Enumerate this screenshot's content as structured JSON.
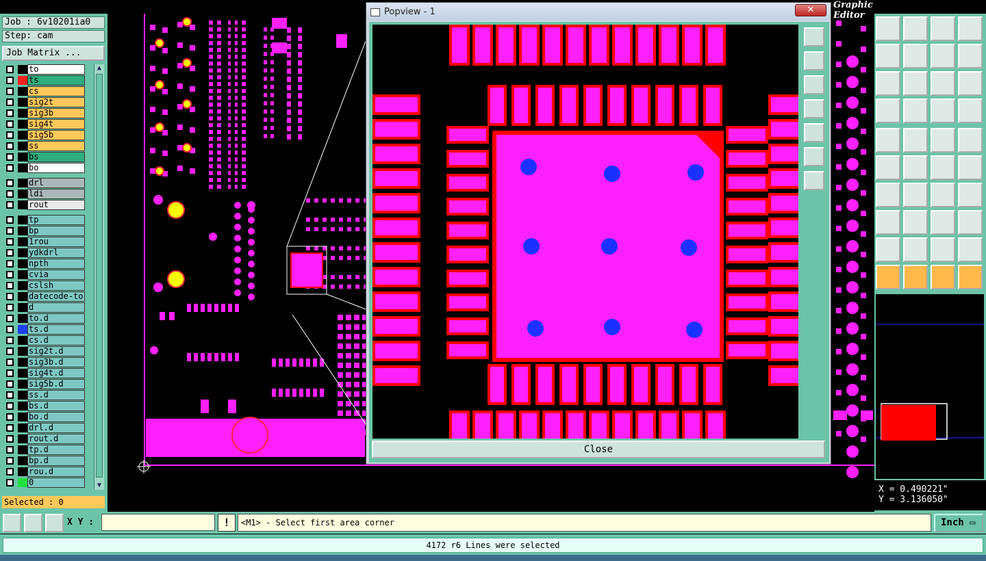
{
  "app": {
    "title": "Graphic Editor"
  },
  "job": {
    "job_label": "Job : 6v10201ia0",
    "step_label": "Step: cam",
    "matrix_button": "Job Matrix ..."
  },
  "layers": [
    {
      "name": "to",
      "color": "#ffffff",
      "chip": "none"
    },
    {
      "name": "ts",
      "color": "#2fae7f",
      "chip": "#ff2020",
      "active": true
    },
    {
      "name": "cs",
      "color": "#ffc85a"
    },
    {
      "name": "sig2t",
      "color": "#ffc85a"
    },
    {
      "name": "sig3b",
      "color": "#ffc85a"
    },
    {
      "name": "sig4t",
      "color": "#ffc85a"
    },
    {
      "name": "sig5b",
      "color": "#ffc85a"
    },
    {
      "name": "ss",
      "color": "#ffc85a"
    },
    {
      "name": "bs",
      "color": "#2fae7f"
    },
    {
      "name": "bo",
      "color": "#ffffff"
    },
    {
      "name": "drl",
      "color": "#a9b8b8"
    },
    {
      "name": "ldi",
      "color": "#a9b8b8"
    },
    {
      "name": "rout",
      "color": "#e8e8e8"
    },
    {
      "name": "tp",
      "color": "#7ec8c4"
    },
    {
      "name": "bp",
      "color": "#7ec8c4"
    },
    {
      "name": "1rou",
      "color": "#7ec8c4"
    },
    {
      "name": "ydkdrl",
      "color": "#7ec8c4"
    },
    {
      "name": "npth",
      "color": "#7ec8c4"
    },
    {
      "name": "cvia",
      "color": "#7ec8c4"
    },
    {
      "name": "cslsh",
      "color": "#7ec8c4"
    },
    {
      "name": "datecode-to",
      "color": "#7ec8c4"
    },
    {
      "name": "d",
      "color": "#7ec8c4"
    },
    {
      "name": "to.d",
      "color": "#7ec8c4"
    },
    {
      "name": "ts.d",
      "color": "#7ec8c4",
      "chip": "#2040ff"
    },
    {
      "name": "cs.d",
      "color": "#7ec8c4"
    },
    {
      "name": "sig2t.d",
      "color": "#7ec8c4"
    },
    {
      "name": "sig3b.d",
      "color": "#7ec8c4"
    },
    {
      "name": "sig4t.d",
      "color": "#7ec8c4"
    },
    {
      "name": "sig5b.d",
      "color": "#7ec8c4"
    },
    {
      "name": "ss.d",
      "color": "#7ec8c4"
    },
    {
      "name": "bs.d",
      "color": "#7ec8c4"
    },
    {
      "name": "bo.d",
      "color": "#7ec8c4"
    },
    {
      "name": "drl.d",
      "color": "#7ec8c4"
    },
    {
      "name": "rout.d",
      "color": "#7ec8c4"
    },
    {
      "name": "tp.d",
      "color": "#7ec8c4"
    },
    {
      "name": "bp.d",
      "color": "#7ec8c4"
    },
    {
      "name": "rou.d",
      "color": "#7ec8c4"
    },
    {
      "name": "0",
      "color": "#7ec8c4",
      "chip": "#20e040"
    }
  ],
  "selection": {
    "label": "Selected : 0"
  },
  "popview": {
    "title": "Popview - 1",
    "close_x": "✕",
    "close_button": "Close"
  },
  "command": {
    "xy_label": "X Y :",
    "xy_value": "",
    "warn": "!",
    "prompt": "<M1> - Select first area corner",
    "unit": "Inch"
  },
  "status": {
    "message": "4172 r6 Lines were selected"
  },
  "coords": {
    "x": "X = 0.490221\"",
    "y": "Y = 3.136050\""
  },
  "colors": {
    "pad": "#ff20ff",
    "pad_outline": "#ff0000",
    "via": "#1a30ff",
    "panel": "#6cc4a8",
    "highlight": "#ffff00"
  },
  "toolbar_icons": [
    "move-icon",
    "snap-icon",
    "home-icon",
    "window-icon",
    "left-icon",
    "right-icon",
    "flip-icon",
    "fit-icon",
    "zoom-fit-icon",
    "center-icon",
    "ratio-icon",
    "help-icon",
    "pan-icon",
    "cursor-icon",
    "layers-icon",
    "layers2-icon",
    "target-icon",
    "red-box-icon",
    "ruler-icon",
    "dot-icon",
    "connect-icon",
    "cross-icon",
    "line1-icon",
    "line2-icon",
    "angle-icon",
    "slash-icon",
    "rotate-icon",
    "ff-icon",
    "route-icon",
    "dash-icon",
    "measure-icon",
    "sq-icon",
    "tri1-icon",
    "tri2-icon",
    "tri3-icon",
    "tri4-icon",
    "arrow-icon",
    "arrow2-icon",
    "arrow3-icon",
    "arrow4-icon"
  ]
}
